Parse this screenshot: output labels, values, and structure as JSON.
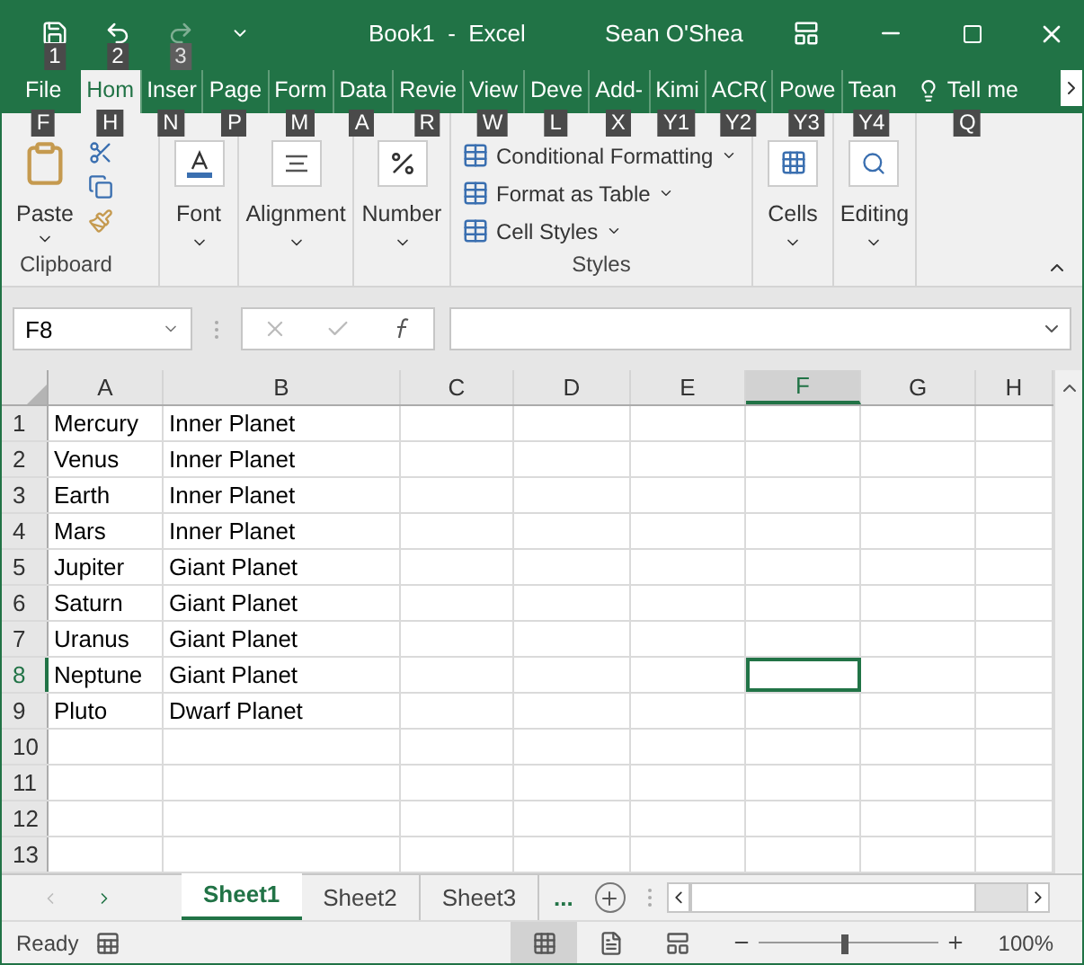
{
  "title_bar": {
    "title": "Book1  -  Excel",
    "user": "Sean O'Shea",
    "quick_access": [
      {
        "kind": "save",
        "keytip": "1",
        "disabled": false
      },
      {
        "kind": "undo",
        "keytip": "2",
        "disabled": false
      },
      {
        "kind": "redo",
        "keytip": "3",
        "disabled": true
      }
    ]
  },
  "ribbon_tabs": [
    {
      "label": "File",
      "keytip": "F",
      "selected": false
    },
    {
      "label": "Hom",
      "keytip": "H",
      "selected": true
    },
    {
      "label": "Inser",
      "keytip": "N",
      "selected": false
    },
    {
      "label": "Page",
      "keytip": "P",
      "selected": false
    },
    {
      "label": "Form",
      "keytip": "M",
      "selected": false
    },
    {
      "label": "Data",
      "keytip": "A",
      "selected": false
    },
    {
      "label": "Revie",
      "keytip": "R",
      "selected": false
    },
    {
      "label": "View",
      "keytip": "W",
      "selected": false
    },
    {
      "label": "Deve",
      "keytip": "L",
      "selected": false
    },
    {
      "label": "Add-",
      "keytip": "X",
      "selected": false
    },
    {
      "label": "Kimi",
      "keytip": "Y1",
      "selected": false
    },
    {
      "label": "ACR(",
      "keytip": "Y2",
      "selected": false
    },
    {
      "label": "Powe",
      "keytip": "Y3",
      "selected": false
    },
    {
      "label": "Tean",
      "keytip": "Y4",
      "selected": false
    }
  ],
  "tell_me": {
    "label": "Tell me",
    "keytip": "Q"
  },
  "ribbon": {
    "clipboard": {
      "label": "Clipboard",
      "paste": "Paste"
    },
    "font": "Font",
    "alignment": "Alignment",
    "number": "Number",
    "styles": {
      "label": "Styles",
      "items": [
        "Conditional Formatting",
        "Format as Table",
        "Cell Styles"
      ]
    },
    "cells": "Cells",
    "editing": "Editing"
  },
  "formula_bar": {
    "name_box": "F8"
  },
  "grid": {
    "columns": [
      {
        "label": "A",
        "selected": false
      },
      {
        "label": "B",
        "selected": false
      },
      {
        "label": "C",
        "selected": false
      },
      {
        "label": "D",
        "selected": false
      },
      {
        "label": "E",
        "selected": false
      },
      {
        "label": "F",
        "selected": true
      },
      {
        "label": "G",
        "selected": false
      },
      {
        "label": "H",
        "selected": false
      }
    ],
    "rows": [
      {
        "label": "1",
        "selected": false,
        "cells": [
          "Mercury",
          "Inner Planet"
        ]
      },
      {
        "label": "2",
        "selected": false,
        "cells": [
          "Venus",
          "Inner Planet"
        ]
      },
      {
        "label": "3",
        "selected": false,
        "cells": [
          "Earth",
          "Inner Planet"
        ]
      },
      {
        "label": "4",
        "selected": false,
        "cells": [
          "Mars",
          "Inner Planet"
        ]
      },
      {
        "label": "5",
        "selected": false,
        "cells": [
          "Jupiter",
          "Giant Planet"
        ]
      },
      {
        "label": "6",
        "selected": false,
        "cells": [
          "Saturn",
          "Giant Planet"
        ]
      },
      {
        "label": "7",
        "selected": false,
        "cells": [
          "Uranus",
          "Giant Planet"
        ]
      },
      {
        "label": "8",
        "selected": true,
        "cells": [
          "Neptune",
          "Giant Planet"
        ]
      },
      {
        "label": "9",
        "selected": false,
        "cells": [
          "Pluto",
          "Dwarf Planet"
        ]
      },
      {
        "label": "10",
        "selected": false,
        "cells": []
      },
      {
        "label": "11",
        "selected": false,
        "cells": []
      },
      {
        "label": "12",
        "selected": false,
        "cells": []
      },
      {
        "label": "13",
        "selected": false,
        "cells": []
      }
    ]
  },
  "sheet_tabs": [
    {
      "label": "Sheet1",
      "selected": true
    },
    {
      "label": "Sheet2",
      "selected": false
    },
    {
      "label": "Sheet3",
      "selected": false
    }
  ],
  "more_sheets": "...",
  "status_bar": {
    "status": "Ready",
    "views": [
      {
        "kind": "normal",
        "selected": true
      },
      {
        "kind": "page_layout",
        "selected": false
      },
      {
        "kind": "page_break",
        "selected": false
      }
    ],
    "zoom_slider": {
      "level": 0.48
    },
    "zoom": "100%"
  }
}
